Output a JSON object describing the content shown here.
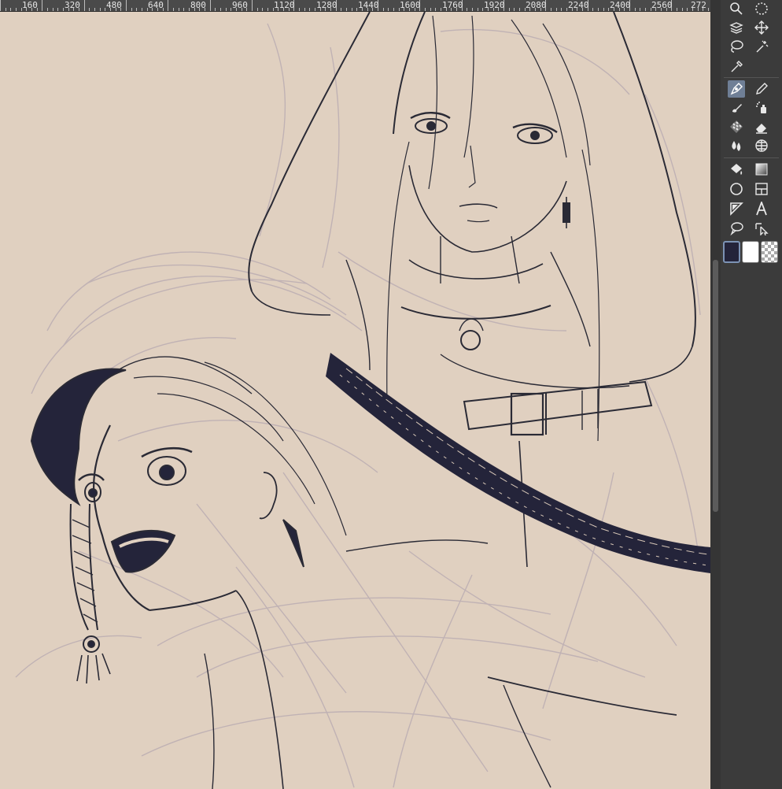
{
  "ruler": {
    "labels": [
      "160",
      "320",
      "480",
      "640",
      "800",
      "960",
      "1120",
      "1280",
      "1440",
      "1600",
      "1760",
      "1920",
      "2080",
      "2240",
      "2400",
      "2560",
      "272"
    ]
  },
  "toolbox": {
    "tools": [
      {
        "name": "zoom",
        "icon": "magnifier-icon"
      },
      {
        "name": "rotate-view",
        "icon": "dotted-rotate-icon"
      },
      {
        "name": "object",
        "icon": "layer-select-icon"
      },
      {
        "name": "move",
        "icon": "move-arrows-icon"
      },
      {
        "name": "lasso-selection",
        "icon": "lasso-icon"
      },
      {
        "name": "auto-select",
        "icon": "magic-wand-icon"
      },
      {
        "name": "eyedropper",
        "icon": "eyedropper-icon"
      },
      {
        "name": "pen",
        "icon": "pen-nib-icon",
        "active": true
      },
      {
        "name": "pencil",
        "icon": "pencil-icon"
      },
      {
        "name": "brush",
        "icon": "brush-icon"
      },
      {
        "name": "airbrush",
        "icon": "airbrush-icon"
      },
      {
        "name": "decoration",
        "icon": "decoration-icon"
      },
      {
        "name": "eraser",
        "icon": "eraser-icon"
      },
      {
        "name": "blend",
        "icon": "blend-drops-icon"
      },
      {
        "name": "grid-ruler",
        "icon": "grid-icon"
      },
      {
        "name": "fill",
        "icon": "fill-bucket-icon"
      },
      {
        "name": "gradient",
        "icon": "gradient-icon"
      },
      {
        "name": "figure",
        "icon": "circle-icon"
      },
      {
        "name": "frame-border",
        "icon": "frame-icon"
      },
      {
        "name": "ruler",
        "icon": "ruler-triangle-icon"
      },
      {
        "name": "text",
        "icon": "text-a-icon"
      },
      {
        "name": "balloon",
        "icon": "speech-balloon-icon"
      },
      {
        "name": "correct-line",
        "icon": "correct-line-icon"
      }
    ]
  },
  "colors": {
    "canvas_bg": "#e0d0c0",
    "ink": "#2a2a35",
    "sketch": "#b6a8b0",
    "panel": "#3b3b3b",
    "active_tool": "#6f7f96",
    "foreground_color": "#24243a",
    "background_color": "#ffffff"
  }
}
